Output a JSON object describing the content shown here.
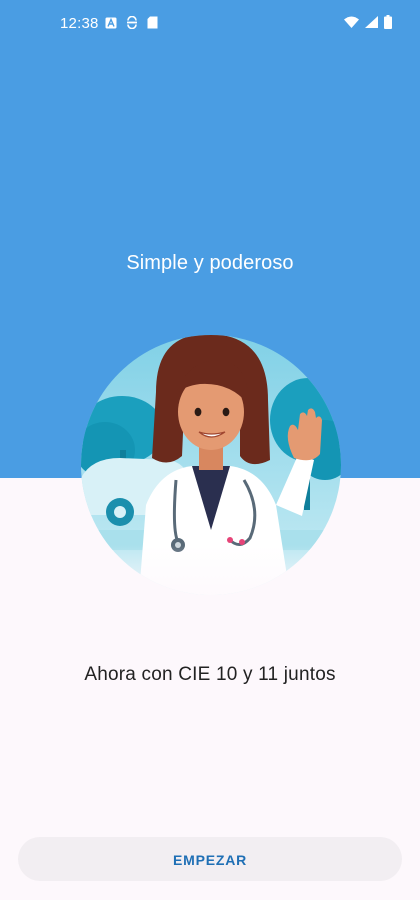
{
  "status_bar": {
    "time": "12:38",
    "left_icons": [
      "a-box-icon",
      "sync-icon",
      "sd-card-icon"
    ],
    "right_icons": [
      "wifi-icon",
      "signal-icon",
      "battery-icon"
    ]
  },
  "onboarding": {
    "headline": "Simple y poderoso",
    "illustration": "doctor-waving-illustration",
    "subtitle": "Ahora con CIE 10 y 11 juntos"
  },
  "actions": {
    "start_label": "EMPEZAR"
  },
  "colors": {
    "header_background": "#4a9de3",
    "page_background": "#fdf8fc",
    "button_text": "#1f6fb5"
  }
}
